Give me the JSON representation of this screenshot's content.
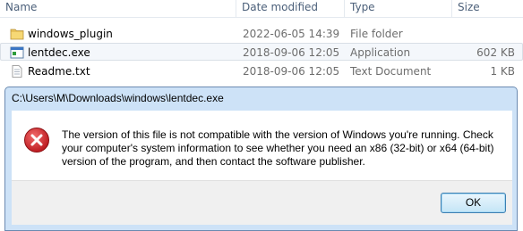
{
  "columns": {
    "name": "Name",
    "date_modified": "Date modified",
    "type": "Type",
    "size": "Size"
  },
  "files": [
    {
      "name": "windows_plugin",
      "date": "2022-06-05 14:39",
      "type": "File folder",
      "size": "",
      "icon": "folder-icon"
    },
    {
      "name": "lentdec.exe",
      "date": "2018-09-06 12:05",
      "type": "Application",
      "size": "602 KB",
      "icon": "application-icon"
    },
    {
      "name": "Readme.txt",
      "date": "2018-09-06 12:05",
      "type": "Text Document",
      "size": "1 KB",
      "icon": "text-document-icon"
    }
  ],
  "dialog": {
    "title": "C:\\Users\\M\\Downloads\\windows\\lentdec.exe",
    "message": "The version of this file is not compatible with the version of Windows you're running. Check your computer's system information to see whether you need an x86 (32-bit) or x64 (64-bit) version of the program, and then contact the software publisher.",
    "ok_label": "OK",
    "icon": "error-icon"
  },
  "colors": {
    "dialog_frame": "#cde2f7",
    "error_red": "#d0272b",
    "selection": "#f4f7fb"
  }
}
